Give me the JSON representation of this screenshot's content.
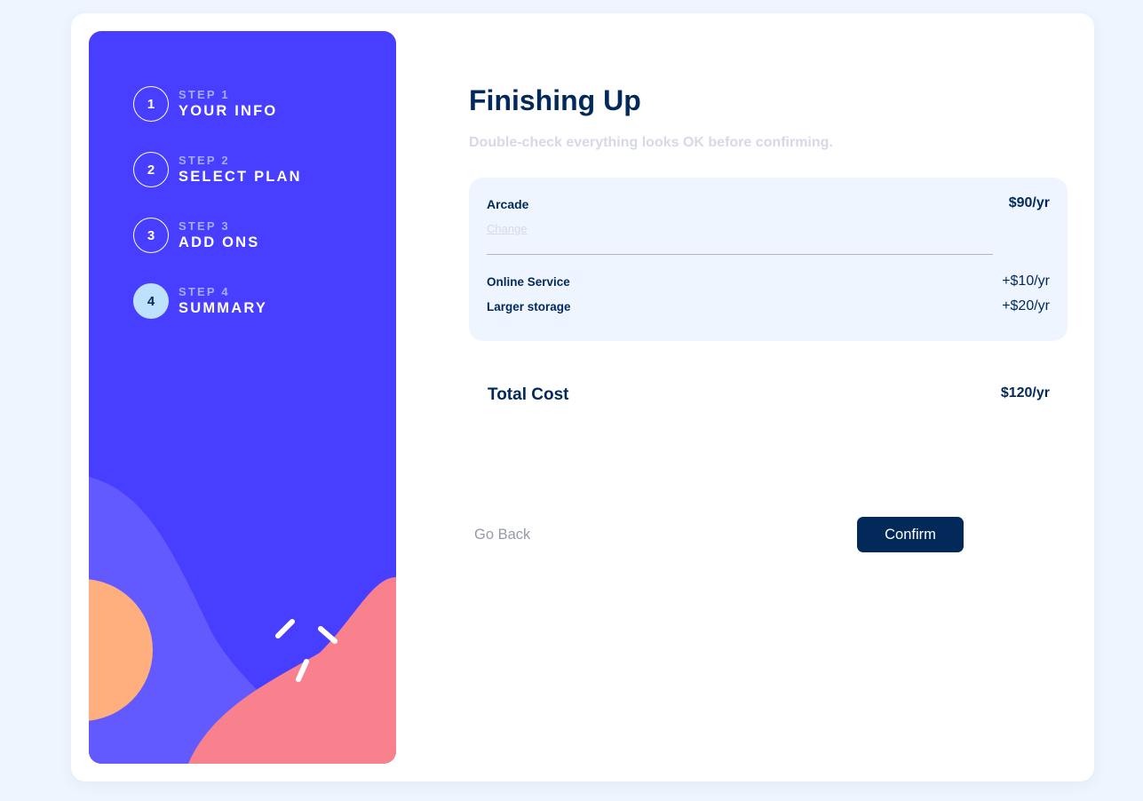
{
  "sidebar": {
    "steps": [
      {
        "number": "1",
        "label": "STEP 1",
        "title": "YOUR INFO",
        "active": false
      },
      {
        "number": "2",
        "label": "STEP 2",
        "title": "SELECT PLAN",
        "active": false
      },
      {
        "number": "3",
        "label": "STEP 3",
        "title": "ADD ONS",
        "active": false
      },
      {
        "number": "4",
        "label": "STEP 4",
        "title": "SUMMARY",
        "active": true
      }
    ]
  },
  "main": {
    "title": "Finishing Up",
    "subtitle": "Double-check everything looks OK before confirming.",
    "summary": {
      "plan_name": "Arcade",
      "plan_price": "$90/yr",
      "change_label": "Change",
      "addons": [
        {
          "name": "Online Service",
          "price": "+$10/yr"
        },
        {
          "name": "Larger storage",
          "price": "+$20/yr"
        }
      ]
    },
    "total": {
      "label": "Total Cost",
      "price": "$120/yr"
    },
    "buttons": {
      "back_label": "Go Back",
      "confirm_label": "Confirm"
    }
  },
  "colors": {
    "page_bg": "#eef5fe",
    "sidebar_bg": "#483eff",
    "active_step": "#bee2fd",
    "marine_blue": "#02295a",
    "cool_gray": "#9699ab",
    "light_gray": "#d6d9e6",
    "shape_orange": "#ffaf7e",
    "shape_pink": "#f9818e",
    "shape_purple": "#6259ff"
  }
}
